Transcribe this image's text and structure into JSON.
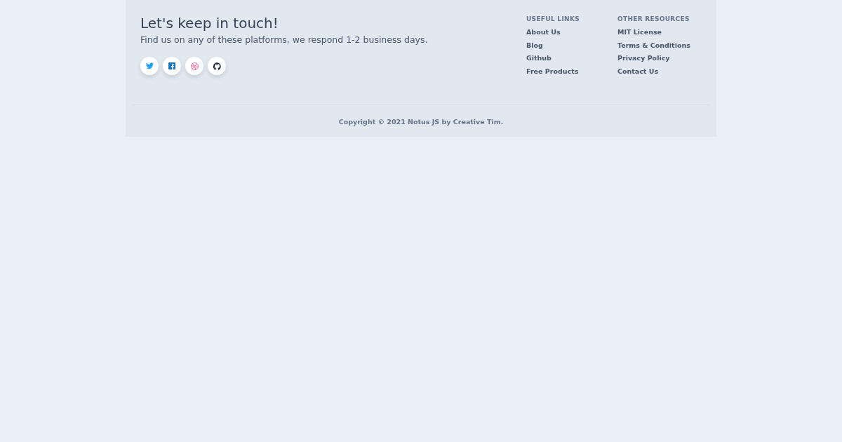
{
  "footer": {
    "title": "Let's keep in touch!",
    "subtitle": "Find us on any of these platforms, we respond 1-2 business days.",
    "social": [
      {
        "kind": "bird"
      },
      {
        "kind": "square"
      },
      {
        "kind": "ball"
      },
      {
        "kind": "cat"
      }
    ],
    "link_groups": [
      {
        "heading": "USEFUL LINKS",
        "links": [
          "About Us",
          "Blog",
          "Github",
          "Free Products"
        ]
      },
      {
        "heading": "OTHER RESOURCES",
        "links": [
          "MIT License",
          "Terms & Conditions",
          "Privacy Policy",
          "Contact Us"
        ]
      }
    ],
    "copyright": "Copyright © 2021 Notus JS by Creative Tim."
  }
}
